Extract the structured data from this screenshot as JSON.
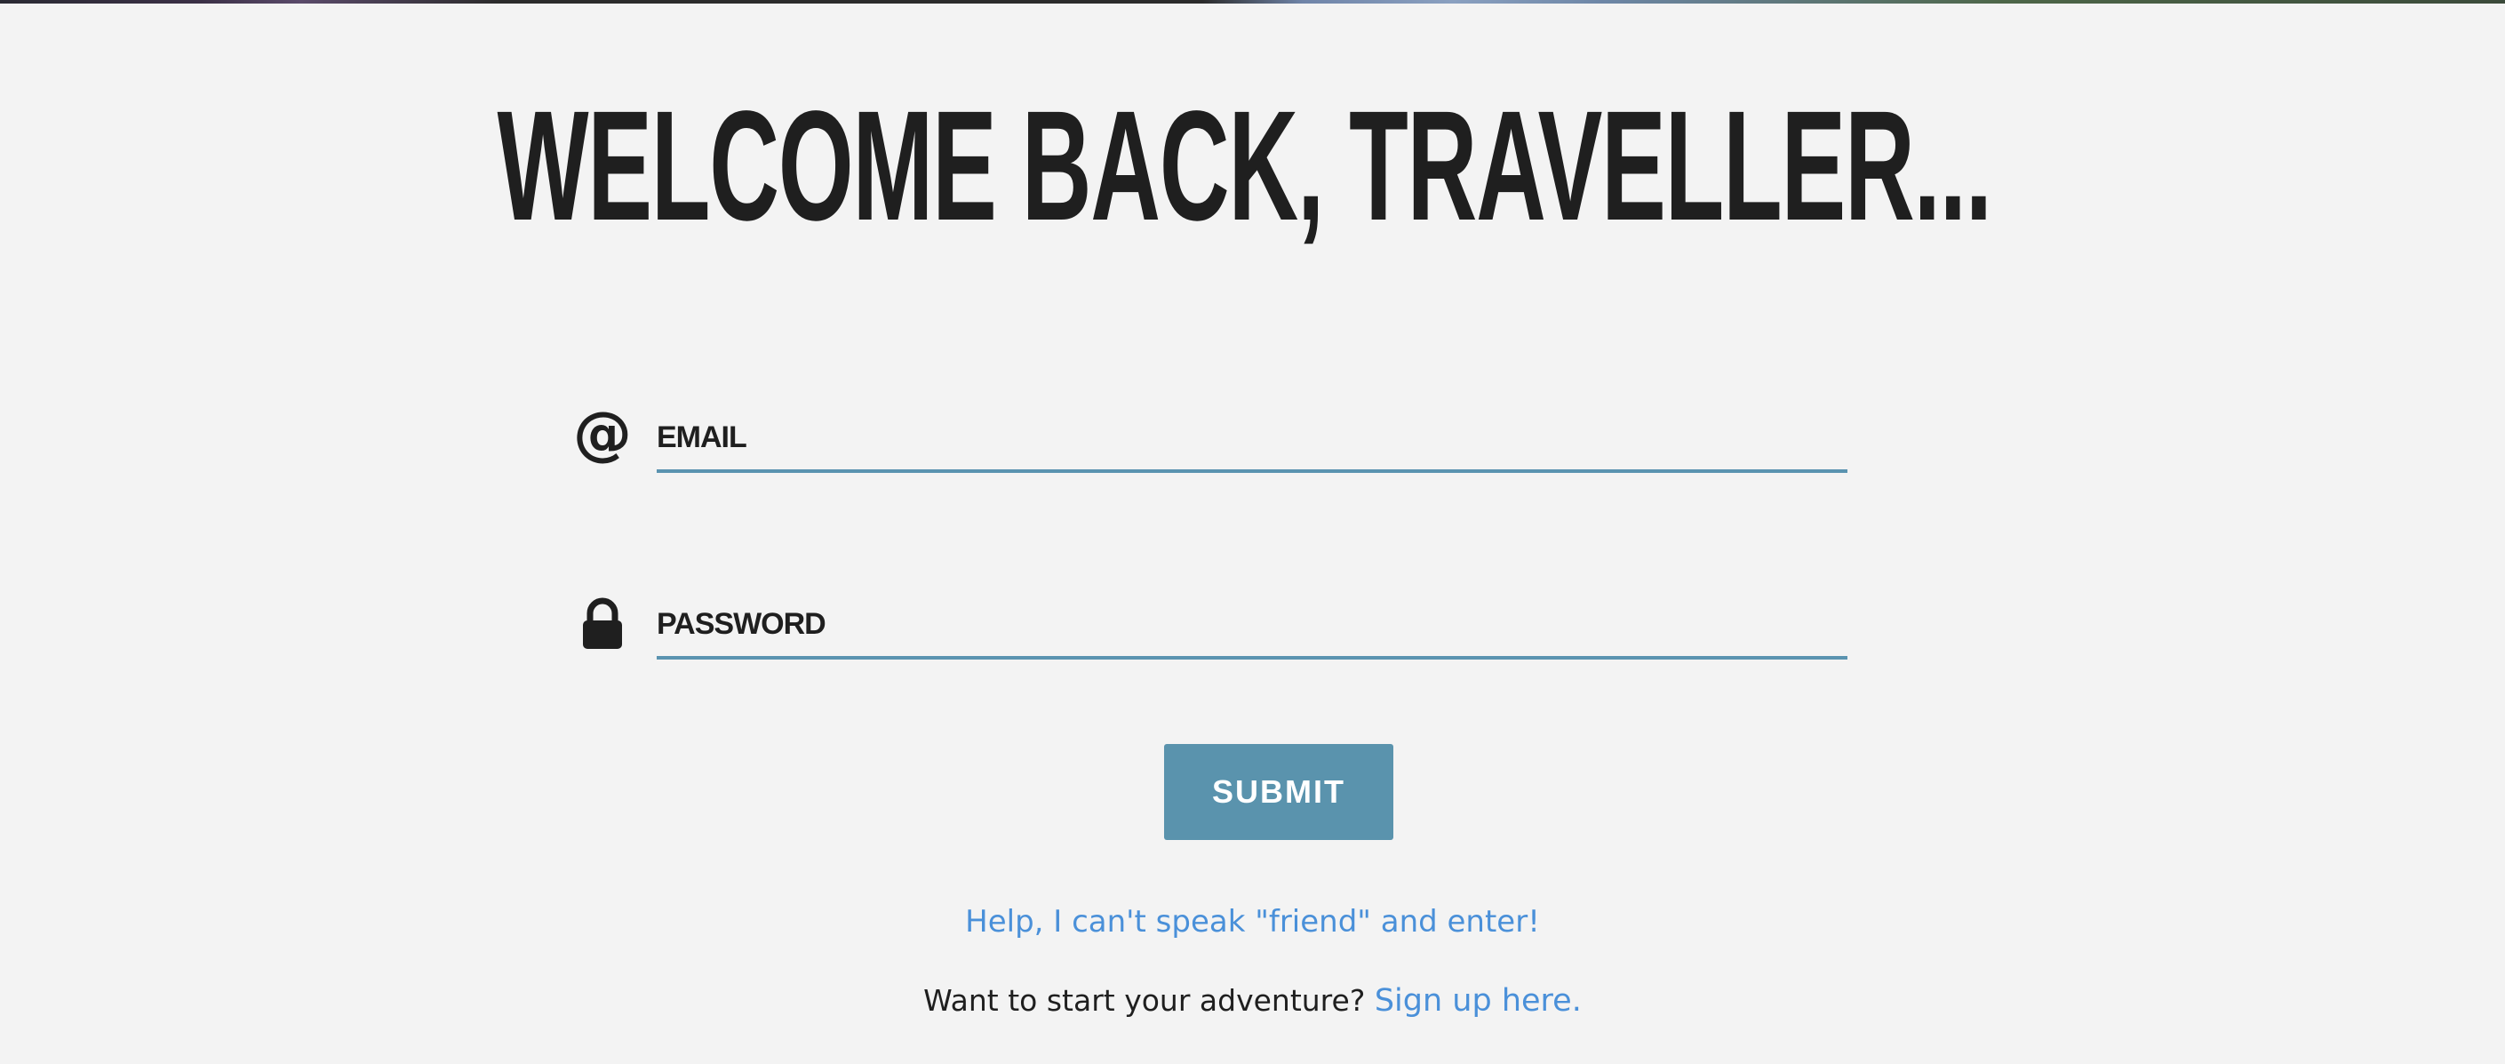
{
  "page": {
    "headline": "WELCOME BACK, TRAVELLER..."
  },
  "form": {
    "email": {
      "placeholder": "EMAIL",
      "value": "",
      "icon": "at-icon"
    },
    "password": {
      "placeholder": "PASSWORD",
      "value": "",
      "icon": "lock-icon"
    },
    "submit_label": "SUBMIT"
  },
  "links": {
    "help_text": "Help, I can't speak \"friend\" and enter!",
    "signup_prompt": "Want to start your adventure?",
    "signup_link": "Sign up here."
  },
  "colors": {
    "background": "#f3f3f3",
    "text": "#1f1f1f",
    "accent": "#5a93ad",
    "link": "#4a90d9"
  }
}
